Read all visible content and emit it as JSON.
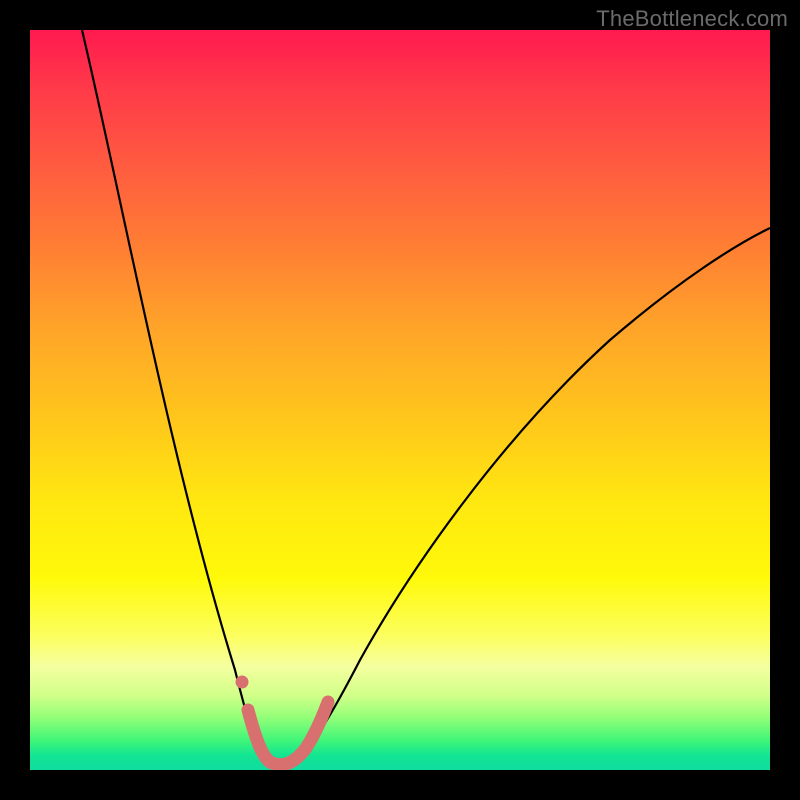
{
  "watermark": "TheBottleneck.com",
  "chart_data": {
    "type": "line",
    "title": "",
    "xlabel": "",
    "ylabel": "",
    "xlim": [
      0,
      100
    ],
    "ylim": [
      0,
      100
    ],
    "series": [
      {
        "name": "left-curve",
        "x": [
          7,
          10,
          13,
          16,
          19,
          22,
          25,
          26.5,
          28,
          29,
          30,
          30.5
        ],
        "y": [
          100,
          88,
          75,
          62,
          49,
          36,
          23,
          16,
          10,
          6,
          3,
          1.5
        ]
      },
      {
        "name": "valley-floor",
        "x": [
          30.5,
          32,
          34,
          36,
          37.5
        ],
        "y": [
          1.5,
          0.6,
          0.4,
          0.6,
          1.5
        ]
      },
      {
        "name": "right-curve",
        "x": [
          37.5,
          40,
          44,
          48,
          53,
          58,
          64,
          70,
          77,
          84,
          92,
          100
        ],
        "y": [
          1.5,
          4,
          9,
          15,
          22,
          29,
          37,
          44,
          52,
          59,
          66,
          72
        ]
      },
      {
        "name": "pink-marker-left-dot",
        "x": [
          28.5
        ],
        "y": [
          12
        ]
      },
      {
        "name": "pink-marker-segment",
        "x": [
          29,
          30,
          31,
          32,
          33,
          34,
          35,
          36,
          37,
          38,
          39
        ],
        "y": [
          6,
          3,
          1.5,
          0.8,
          0.5,
          0.5,
          0.8,
          1.5,
          3,
          5,
          8
        ]
      }
    ],
    "colors": {
      "curve": "#000000",
      "marker": "#d8706f"
    },
    "background_gradient": {
      "direction": "vertical",
      "stops": [
        {
          "pos": 0.0,
          "color": "#ff1a4f"
        },
        {
          "pos": 0.5,
          "color": "#ffd218"
        },
        {
          "pos": 0.8,
          "color": "#fcff60"
        },
        {
          "pos": 1.0,
          "color": "#10dca0"
        }
      ]
    }
  }
}
